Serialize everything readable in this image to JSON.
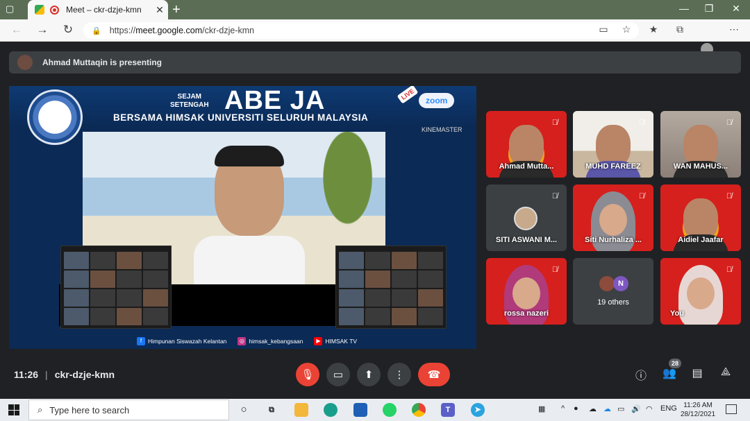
{
  "browser": {
    "tab_title": "Meet – ckr-dzje-kmn",
    "tab_close": "✕",
    "new_tab": "+",
    "url_prefix": "https://",
    "url_host": "meet.google.com",
    "url_path": "/ckr-dzje-kmn"
  },
  "meet": {
    "presenting_text": "Ahmad Muttaqin is presenting",
    "time": "11:26",
    "separator": "|",
    "meeting_code": "ckr-dzje-kmn",
    "participants_count": "28"
  },
  "presentation": {
    "sejam": "SEJAM",
    "setengah": "SETENGAH",
    "title": "ABE JA",
    "subtitle": "BERSAMA HIMSAK UNIVERSITI SELURUH MALAYSIA",
    "live": "LIVE",
    "zoom": "zoom",
    "kinemaster": "KINEMASTER",
    "footer_fb": "Himpunan Siswazah Kelantan",
    "footer_ig": "himsak_kebangsaan",
    "footer_yt": "HIMSAK TV"
  },
  "tiles": [
    {
      "name": "Ahmad Mutta..."
    },
    {
      "name": "MUHD FAREEZ"
    },
    {
      "name": "WAN MAHUS..."
    },
    {
      "name": "SITI ASWANI M..."
    },
    {
      "name": "Siti Nurhaliza ..."
    },
    {
      "name": "Aidiel Jaafar"
    },
    {
      "name": "rossa nazeri"
    },
    {
      "name": "19 others",
      "avatar_letter": "N"
    },
    {
      "name": "You"
    }
  ],
  "taskbar": {
    "search_placeholder": "Type here to search",
    "lang": "ENG",
    "clock_time": "11:26 AM",
    "clock_date": "28/12/2021"
  },
  "colors": {
    "meet_bg": "#202124",
    "end_call": "#ea4335",
    "titlebar": "#5b6e55"
  }
}
